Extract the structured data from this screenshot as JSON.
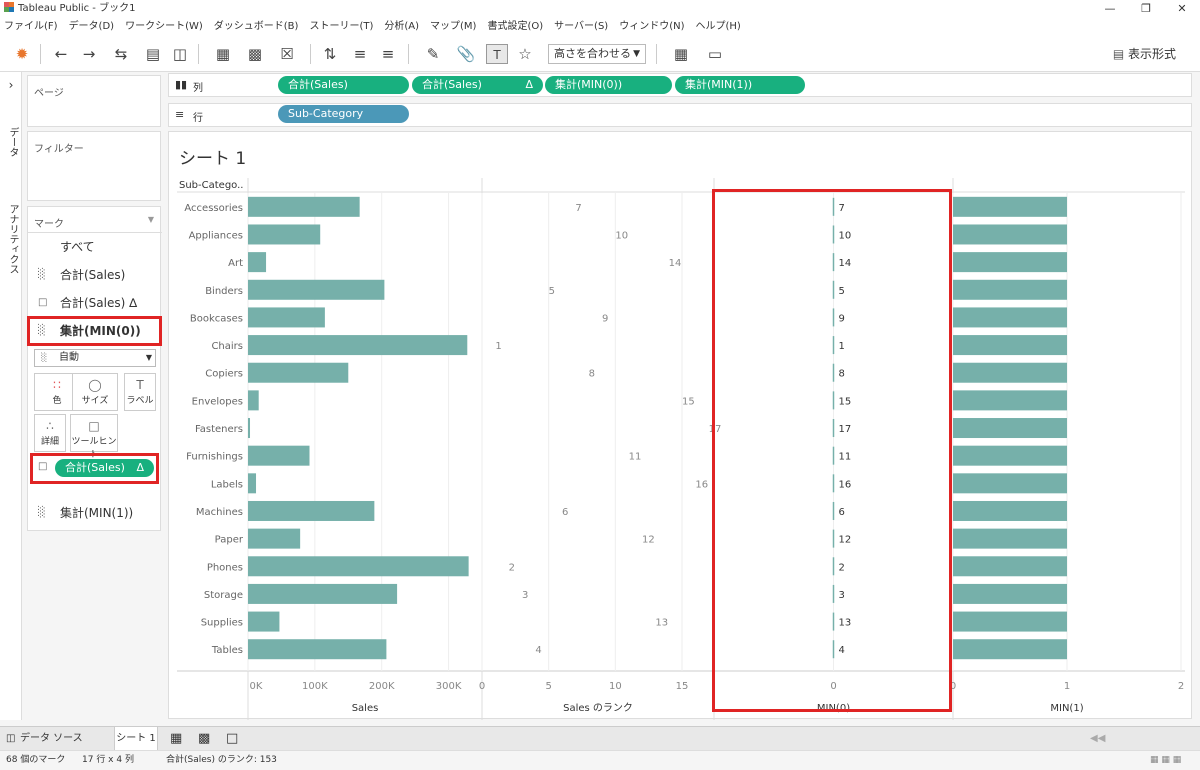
{
  "window": {
    "title": "Tableau Public - ブック1"
  },
  "menu": [
    "ファイル(F)",
    "データ(D)",
    "ワークシート(W)",
    "ダッシュボード(B)",
    "ストーリー(T)",
    "分析(A)",
    "マップ(M)",
    "書式設定(O)",
    "サーバー(S)",
    "ウィンドウ(N)",
    "ヘルプ(H)"
  ],
  "toolbar": {
    "fit_label": "高さを合わせる",
    "show_me": "表示形式"
  },
  "left_rail": {
    "data_tab": "データ",
    "analytics_tab": "アナリティクス"
  },
  "cards": {
    "pages": "ページ",
    "filters": "フィルター",
    "marks": "マーク"
  },
  "marks": {
    "all": "すべて",
    "sum_sales": "合計(Sales)",
    "sum_sales_delta": "合計(Sales) ∆",
    "min0": "集計(MIN(0))",
    "mark_type": "自動",
    "color": "色",
    "size": "サイズ",
    "label": "ラベル",
    "detail": "詳細",
    "tooltip": "ツールヒント",
    "label_pill": "合計(Sales)",
    "min1": "集計(MIN(1))"
  },
  "shelves": {
    "columns_label": "列",
    "rows_label": "行",
    "columns": [
      "合計(Sales)",
      "合計(Sales)",
      "集計(MIN(0))",
      "集計(MIN(1))"
    ],
    "rows": [
      "Sub-Category"
    ]
  },
  "sheet": {
    "title": "シート 1",
    "row_header": "Sub-Catego.."
  },
  "chart_data": {
    "type": "bar",
    "categories": [
      "Accessories",
      "Appliances",
      "Art",
      "Binders",
      "Bookcases",
      "Chairs",
      "Copiers",
      "Envelopes",
      "Fasteners",
      "Furnishings",
      "Labels",
      "Machines",
      "Paper",
      "Phones",
      "Storage",
      "Supplies",
      "Tables"
    ],
    "series": [
      {
        "name": "Sales",
        "values": [
          167000,
          108000,
          27000,
          204000,
          115000,
          328000,
          150000,
          16000,
          3000,
          92000,
          12000,
          189000,
          78000,
          330000,
          223000,
          47000,
          207000
        ]
      },
      {
        "name": "Sales のランク",
        "values": [
          7,
          10,
          14,
          5,
          9,
          1,
          8,
          15,
          17,
          11,
          16,
          6,
          12,
          2,
          3,
          13,
          4
        ]
      },
      {
        "name": "MIN(0)",
        "values": [
          0,
          0,
          0,
          0,
          0,
          0,
          0,
          0,
          0,
          0,
          0,
          0,
          0,
          0,
          0,
          0,
          0
        ]
      },
      {
        "name": "MIN(1)",
        "values": [
          1,
          1,
          1,
          1,
          1,
          1,
          1,
          1,
          1,
          1,
          1,
          1,
          1,
          1,
          1,
          1,
          1
        ]
      }
    ],
    "axes": [
      {
        "title": "Sales",
        "ticks": [
          "0K",
          "100K",
          "200K",
          "300K"
        ]
      },
      {
        "title": "Sales のランク",
        "ticks": [
          "0",
          "5",
          "10",
          "15"
        ]
      },
      {
        "title": "MIN(0)",
        "ticks": [
          "0"
        ]
      },
      {
        "title": "MIN(1)",
        "ticks": [
          "0",
          "1",
          "2"
        ]
      }
    ],
    "bar_color": "#76b0aa"
  },
  "bottom": {
    "datasource": "データ ソース",
    "sheet_tab": "シート 1"
  },
  "status": {
    "marks_count": "68 個のマーク",
    "dims": "17 行 x 4 列",
    "rank_info": "合計(Sales) のランク: 153"
  },
  "colors": {
    "pill_green": "#18b07f",
    "pill_blue": "#4b98b8",
    "highlight_red": "#e02424"
  }
}
